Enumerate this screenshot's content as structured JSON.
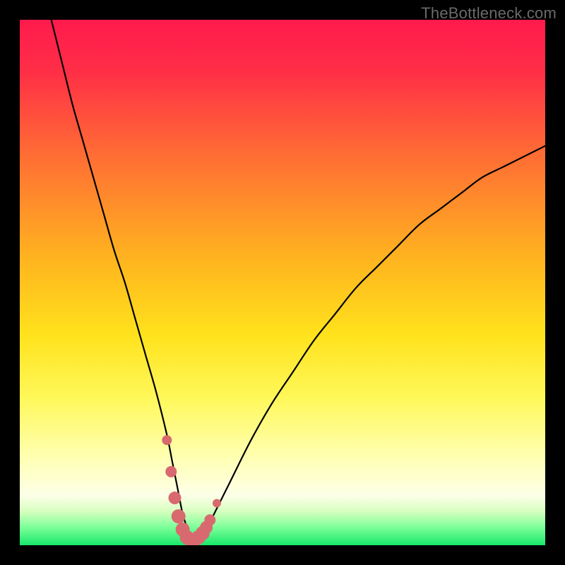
{
  "watermark": "TheBottleneck.com",
  "chart_data": {
    "type": "line",
    "title": "",
    "xlabel": "",
    "ylabel": "",
    "xlim": [
      0,
      100
    ],
    "ylim": [
      0,
      100
    ],
    "grid": false,
    "background_gradient_stops": [
      {
        "offset": 0.0,
        "color": "#ff1a4d"
      },
      {
        "offset": 0.1,
        "color": "#ff2f46"
      },
      {
        "offset": 0.25,
        "color": "#ff6a35"
      },
      {
        "offset": 0.45,
        "color": "#ffb21f"
      },
      {
        "offset": 0.6,
        "color": "#ffe21c"
      },
      {
        "offset": 0.72,
        "color": "#fff85a"
      },
      {
        "offset": 0.83,
        "color": "#ffffb0"
      },
      {
        "offset": 0.905,
        "color": "#fdffe8"
      },
      {
        "offset": 0.935,
        "color": "#d8ffc0"
      },
      {
        "offset": 0.965,
        "color": "#7fff9a"
      },
      {
        "offset": 1.0,
        "color": "#18e86b"
      }
    ],
    "series": [
      {
        "name": "bottleneck-curve",
        "x": [
          6,
          8,
          10,
          12,
          14,
          16,
          18,
          20,
          22,
          24,
          26,
          28,
          29,
          30,
          31,
          32,
          33,
          34,
          35,
          36,
          38,
          40,
          44,
          48,
          52,
          56,
          60,
          64,
          68,
          72,
          76,
          80,
          84,
          88,
          92,
          96,
          100
        ],
        "y": [
          100,
          92,
          84,
          77,
          70,
          63,
          56,
          50,
          43,
          36,
          29,
          21,
          16,
          11,
          6,
          3,
          1,
          1,
          2,
          4,
          8,
          12,
          20,
          27,
          33,
          39,
          44,
          49,
          53,
          57,
          61,
          64,
          67,
          70,
          72,
          74,
          76
        ]
      }
    ],
    "highlight": {
      "name": "valley-highlight",
      "color": "#d86a6f",
      "x": [
        28.0,
        28.8,
        29.5,
        30.2,
        31.0,
        31.8,
        32.5,
        33.3,
        34.0,
        34.8,
        35.5,
        36.2,
        37.5
      ],
      "y": [
        20.0,
        14.0,
        9.0,
        5.5,
        3.0,
        1.5,
        1.0,
        1.0,
        1.5,
        2.3,
        3.4,
        4.8,
        8.0
      ],
      "radius": [
        7,
        8,
        9,
        10,
        10,
        10,
        10,
        10,
        10,
        10,
        9,
        8,
        6
      ]
    }
  }
}
